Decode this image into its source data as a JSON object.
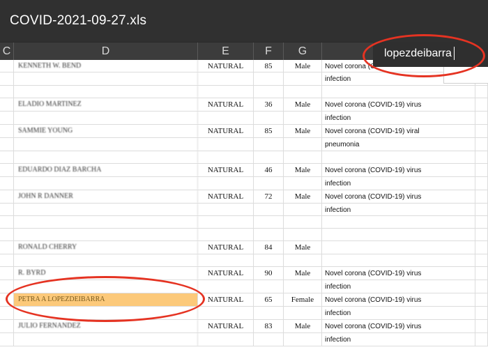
{
  "window": {
    "title": "COVID-2021-09-27.xls"
  },
  "columns": [
    {
      "id": "C",
      "label": "C"
    },
    {
      "id": "D",
      "label": "D"
    },
    {
      "id": "E",
      "label": "E"
    },
    {
      "id": "F",
      "label": "F"
    },
    {
      "id": "G",
      "label": "G"
    },
    {
      "id": "H",
      "label": ""
    }
  ],
  "search": {
    "value": "lopezdeibarra",
    "placeholder": ""
  },
  "accent_colors": {
    "highlight": "#fcc97a",
    "annotation_circle": "#e53322"
  },
  "rows": [
    {
      "name": "KENNETH W. BEND",
      "kind": "NATURAL",
      "age": "85",
      "sex": "Male",
      "cause": "Novel corona (C"
    },
    {
      "name": "",
      "kind": "",
      "age": "",
      "sex": "",
      "cause": "infection"
    },
    {
      "name": "",
      "kind": "",
      "age": "",
      "sex": "",
      "cause": ""
    },
    {
      "name": "ELADIO MARTINEZ",
      "kind": "NATURAL",
      "age": "36",
      "sex": "Male",
      "cause": "Novel corona (COVID-19) virus"
    },
    {
      "name": "",
      "kind": "",
      "age": "",
      "sex": "",
      "cause": "infection"
    },
    {
      "name": "SAMMIE YOUNG",
      "kind": "NATURAL",
      "age": "85",
      "sex": "Male",
      "cause": "Novel corona (COVID-19) viral"
    },
    {
      "name": "",
      "kind": "",
      "age": "",
      "sex": "",
      "cause": "pneumonia"
    },
    {
      "name": "",
      "kind": "",
      "age": "",
      "sex": "",
      "cause": ""
    },
    {
      "name": "EDUARDO DIAZ BARCHA",
      "kind": "NATURAL",
      "age": "46",
      "sex": "Male",
      "cause": "Novel corona (COVID-19) virus"
    },
    {
      "name": "",
      "kind": "",
      "age": "",
      "sex": "",
      "cause": "infection"
    },
    {
      "name": "JOHN R DANNER",
      "kind": "NATURAL",
      "age": "72",
      "sex": "Male",
      "cause": "Novel corona (COVID-19) virus"
    },
    {
      "name": "",
      "kind": "",
      "age": "",
      "sex": "",
      "cause": "infection"
    },
    {
      "name": "",
      "kind": "",
      "age": "",
      "sex": "",
      "cause": ""
    },
    {
      "name": "",
      "kind": "",
      "age": "",
      "sex": "",
      "cause": ""
    },
    {
      "name": "RONALD CHERRY",
      "kind": "NATURAL",
      "age": "84",
      "sex": "Male",
      "cause": ""
    },
    {
      "name": "",
      "kind": "",
      "age": "",
      "sex": "",
      "cause": ""
    },
    {
      "name": "R. BYRD",
      "kind": "NATURAL",
      "age": "90",
      "sex": "Male",
      "cause": "Novel corona (COVID-19) virus"
    },
    {
      "name": "",
      "kind": "",
      "age": "",
      "sex": "",
      "cause": "infection"
    },
    {
      "name": "PETRA A LOPEZDEIBARRA",
      "kind": "NATURAL",
      "age": "65",
      "sex": "Female",
      "cause": "Novel corona (COVID-19) virus",
      "highlight": true
    },
    {
      "name": "",
      "kind": "",
      "age": "",
      "sex": "",
      "cause": "infection"
    },
    {
      "name": "JULIO FERNANDEZ",
      "kind": "NATURAL",
      "age": "83",
      "sex": "Male",
      "cause": "Novel corona (COVID-19) virus"
    },
    {
      "name": "",
      "kind": "",
      "age": "",
      "sex": "",
      "cause": "infection"
    }
  ]
}
